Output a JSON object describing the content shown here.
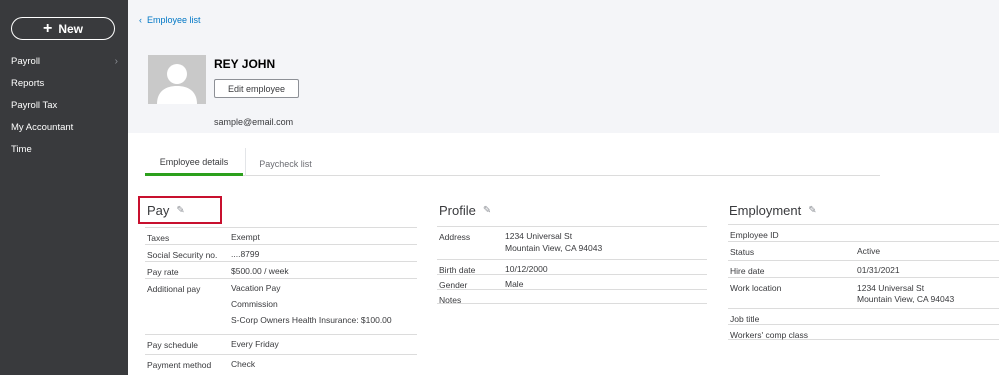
{
  "sidebar": {
    "new_label": "New",
    "items": [
      {
        "label": "Payroll",
        "has_chevron": true
      },
      {
        "label": "Reports"
      },
      {
        "label": "Payroll Tax"
      },
      {
        "label": "My Accountant"
      },
      {
        "label": "Time"
      }
    ]
  },
  "header": {
    "breadcrumb": "Employee list",
    "employee_name": "REY JOHN",
    "edit_button": "Edit employee",
    "email": "sample@email.com"
  },
  "tabs": [
    {
      "label": "Employee details",
      "active": true
    },
    {
      "label": "Paycheck list",
      "active": false
    }
  ],
  "pay": {
    "title": "Pay",
    "rows": [
      {
        "label": "Taxes",
        "value": "Exempt"
      },
      {
        "label": "Social Security no.",
        "value": "....8799"
      },
      {
        "label": "Pay rate",
        "value": "$500.00 / week"
      },
      {
        "label": "Additional pay",
        "values": [
          "Vacation Pay",
          "Commission",
          "S-Corp Owners Health Insurance: $100.00"
        ]
      },
      {
        "label": "Pay schedule",
        "value": "Every Friday"
      },
      {
        "label": "Payment method",
        "value": "Check"
      }
    ]
  },
  "profile": {
    "title": "Profile",
    "rows": [
      {
        "label": "Address",
        "values": [
          "1234 Universal St",
          "Mountain View, CA 94043"
        ]
      },
      {
        "label": "Birth date",
        "value": "10/12/2000"
      },
      {
        "label": "Gender",
        "value": "Male"
      },
      {
        "label": "Notes",
        "value": ""
      }
    ]
  },
  "employment": {
    "title": "Employment",
    "rows": [
      {
        "label": "Employee ID",
        "value": ""
      },
      {
        "label": "Status",
        "value": "Active"
      },
      {
        "label": "Hire date",
        "value": "01/31/2021"
      },
      {
        "label": "Work location",
        "values": [
          "1234 Universal St",
          "Mountain View, CA 94043"
        ]
      },
      {
        "label": "Job title",
        "value": ""
      },
      {
        "label": "Workers' comp class",
        "value": ""
      }
    ]
  },
  "colors": {
    "sidebar_bg": "#393a3d",
    "header_bg": "#f4f5f8",
    "link": "#0077c5",
    "active_tab": "#2ca01c",
    "highlight_box": "#c8102e"
  },
  "icons": [
    "plus-icon",
    "chevron-right-icon",
    "chevron-left-icon",
    "avatar-placeholder-icon",
    "pencil-icon"
  ]
}
